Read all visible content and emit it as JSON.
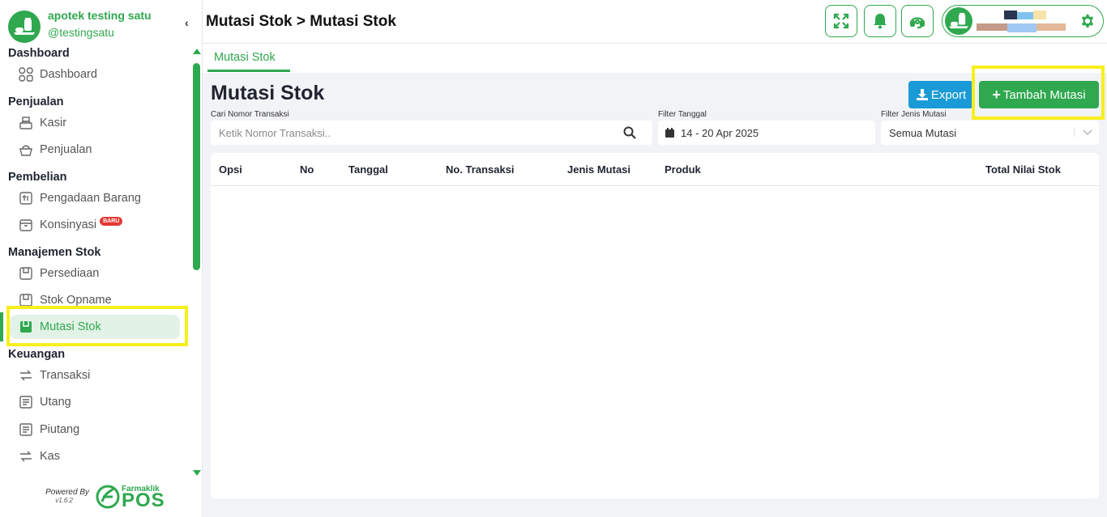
{
  "brand": {
    "name": "apotek testing satu",
    "handle": "@testingsatu"
  },
  "sidebar": {
    "sections": [
      {
        "title": "Dashboard",
        "items": [
          {
            "label": "Dashboard",
            "icon": "grid-icon"
          }
        ]
      },
      {
        "title": "Penjualan",
        "items": [
          {
            "label": "Kasir",
            "icon": "cash-register-icon"
          },
          {
            "label": "Penjualan",
            "icon": "basket-icon"
          }
        ]
      },
      {
        "title": "Pembelian",
        "items": [
          {
            "label": "Pengadaan Barang",
            "icon": "box-in-icon"
          },
          {
            "label": "Konsinyasi",
            "icon": "drawer-icon",
            "badge": "BARU"
          }
        ]
      },
      {
        "title": "Manajemen Stok",
        "items": [
          {
            "label": "Persediaan",
            "icon": "package-icon"
          },
          {
            "label": "Stok Opname",
            "icon": "package-icon"
          },
          {
            "label": "Mutasi Stok",
            "icon": "package-icon",
            "active": true
          }
        ]
      },
      {
        "title": "Keuangan",
        "items": [
          {
            "label": "Transaksi",
            "icon": "transfer-icon"
          },
          {
            "label": "Utang",
            "icon": "receipt-icon"
          },
          {
            "label": "Piutang",
            "icon": "receipt-icon"
          },
          {
            "label": "Kas",
            "icon": "transfer-icon"
          }
        ]
      }
    ]
  },
  "footer": {
    "powered_by": "Powered By",
    "version": "v1.6.2",
    "brand_small": "Farmaklik",
    "brand_big": "POS"
  },
  "header": {
    "breadcrumb": "Mutasi Stok > Mutasi Stok"
  },
  "tabs": [
    {
      "label": "Mutasi Stok",
      "active": true
    }
  ],
  "main": {
    "title": "Mutasi Stok",
    "export_label": "Export",
    "add_label": "Tambah Mutasi",
    "filters": {
      "search": {
        "label": "Cari Nomor Transaksi",
        "placeholder": "Ketik Nomor Transaksi.."
      },
      "date": {
        "label": "Filter Tanggal",
        "value": "14 - 20 Apr 2025"
      },
      "type": {
        "label": "Filter Jenis Mutasi",
        "value": "Semua Mutasi"
      }
    },
    "table": {
      "columns": [
        "Opsi",
        "No",
        "Tanggal",
        "No. Transaksi",
        "Jenis Mutasi",
        "Produk",
        "Total Nilai Stok"
      ],
      "rows": []
    }
  },
  "colors": {
    "brand_green": "#2fa84f",
    "export_blue": "#1a9ad6",
    "highlight_yellow": "#f7ef1d"
  }
}
